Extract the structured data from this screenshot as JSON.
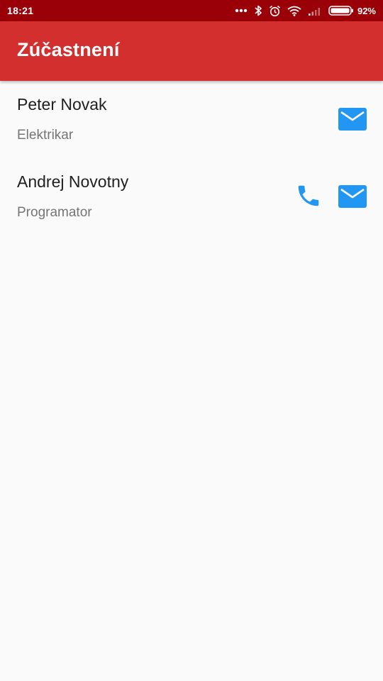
{
  "status_bar": {
    "time": "18:21",
    "battery_percent": "92%",
    "icons": [
      "more-dots-icon",
      "bluetooth-icon",
      "alarm-icon",
      "wifi-icon",
      "signal-icon",
      "battery-icon"
    ]
  },
  "app_bar": {
    "title": "Zúčastnení",
    "color": "#d32f2f"
  },
  "participants": [
    {
      "name": "Peter Novak",
      "role": "Elektrikar",
      "actions": [
        "mail-icon"
      ]
    },
    {
      "name": "Andrej Novotny",
      "role": "Programator",
      "actions": [
        "phone-icon",
        "mail-icon"
      ]
    }
  ],
  "colors": {
    "status_bar": "#9a0007",
    "accent_icon": "#2196f3",
    "background": "#fafafa"
  }
}
